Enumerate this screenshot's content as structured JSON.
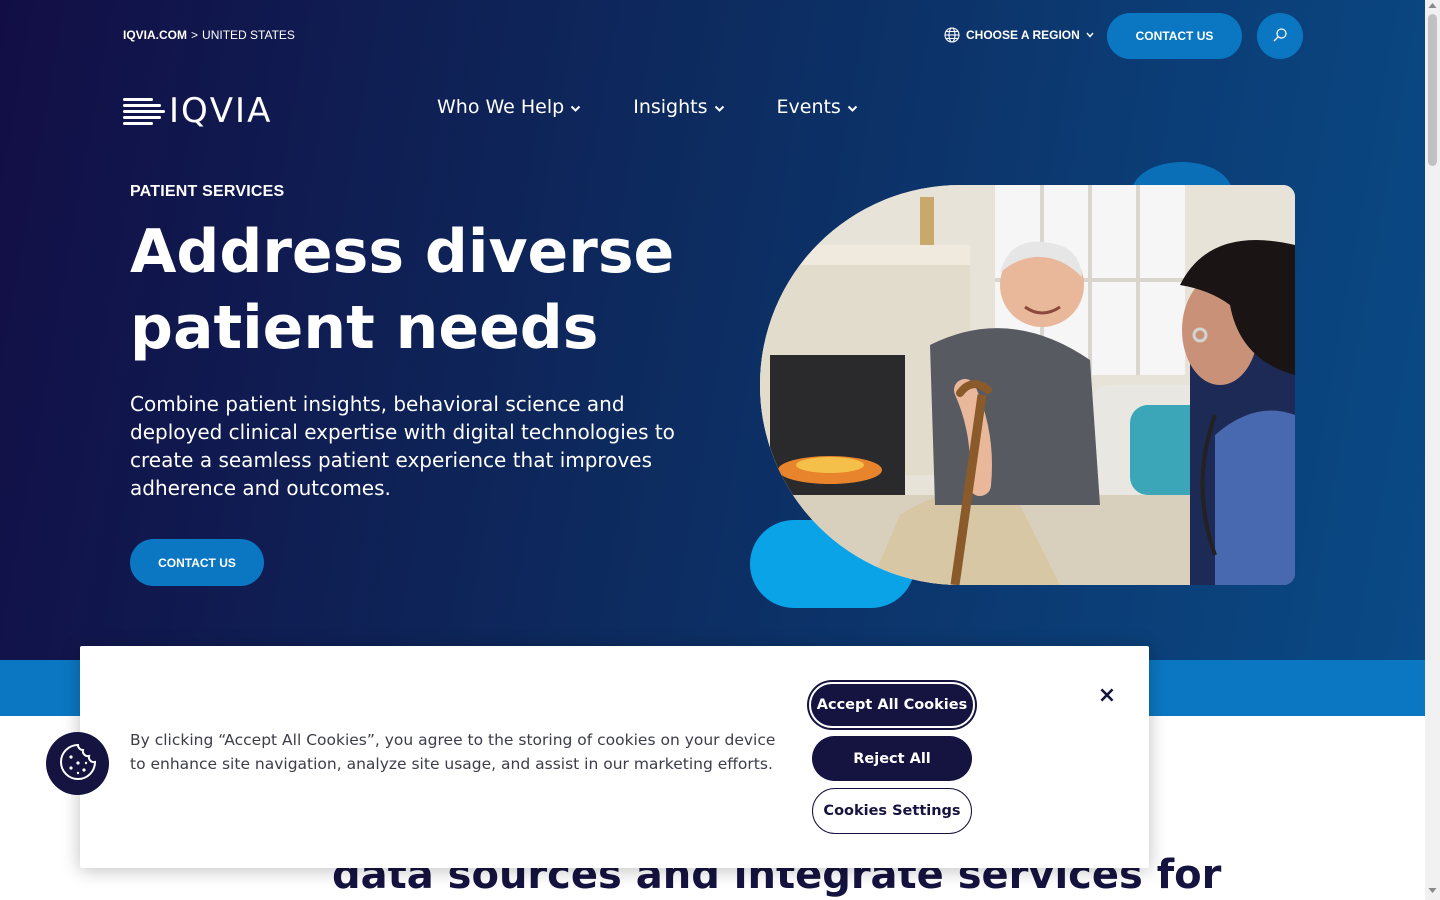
{
  "header": {
    "breadcrumb_root": "IQVIA.COM",
    "breadcrumb_sep": ">",
    "breadcrumb_current": "UNITED STATES",
    "region_label": "CHOOSE A REGION",
    "contact_label": "CONTACT US",
    "logo_text": "IQVIA"
  },
  "nav": {
    "items": [
      {
        "label": "Who We Help"
      },
      {
        "label": "Insights"
      },
      {
        "label": "Events"
      }
    ]
  },
  "hero": {
    "eyebrow": "PATIENT SERVICES",
    "title": "Address diverse patient needs",
    "description": "Combine patient insights, behavioral science and deployed clinical expertise with digital technologies to create a seamless patient experience that improves adherence and outcomes.",
    "cta_label": "CONTACT US"
  },
  "below": {
    "heading_fragment": "data sources and integrate services for"
  },
  "cookie": {
    "text": "By clicking “Accept All Cookies”, you agree to the storing of cookies on your device to enhance site navigation, analyze site usage, and assist in our marketing efforts.",
    "accept_label": "Accept All Cookies",
    "reject_label": "Reject All",
    "settings_label": "Cookies Settings",
    "close_glyph": "×"
  },
  "colors": {
    "hero_dark": "#120e45",
    "hero_blue": "#0a4a86",
    "accent_blue": "#0b77c2",
    "cyan_blob": "#0aa3e8",
    "navy": "#15133f"
  },
  "icons": {
    "region": "globe-icon",
    "search": "search-icon",
    "nav_chevron": "chevron-down-icon",
    "cookie": "cookie-icon",
    "close": "close-icon"
  }
}
